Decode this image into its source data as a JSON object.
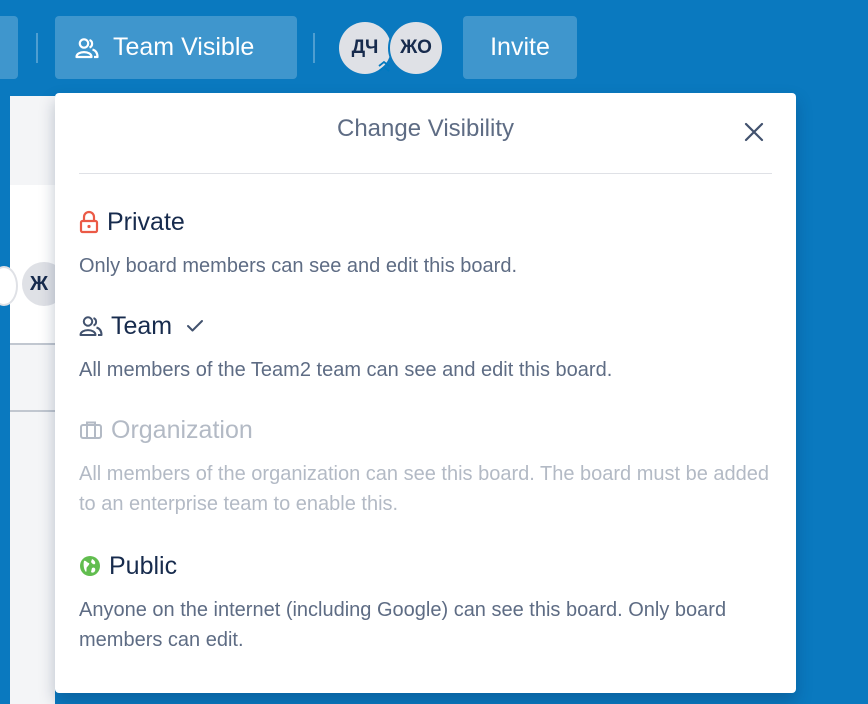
{
  "header": {
    "visibility_button_label": "Team Visible",
    "members": [
      {
        "initials": "ДЧ"
      },
      {
        "initials": "ЖО"
      }
    ],
    "invite_label": "Invite"
  },
  "board_background": {
    "partial_avatar_initial": "Ж"
  },
  "popover": {
    "title": "Change Visibility",
    "options": [
      {
        "label": "Private",
        "description": "Only board members can see and edit this board.",
        "icon": "lock-icon",
        "color": "#eb5a46",
        "selected": false,
        "disabled": false
      },
      {
        "label": "Team",
        "description": "All members of the Team2 team can see and edit this board.",
        "icon": "team-icon",
        "color": "#5e6c84",
        "selected": true,
        "disabled": false
      },
      {
        "label": "Organization",
        "description": "All members of the organization can see this board. The board must be added to an enterprise team to enable this.",
        "icon": "organization-icon",
        "color": "#b3bac5",
        "selected": false,
        "disabled": true
      },
      {
        "label": "Public",
        "description": "Anyone on the internet (including Google) can see this board. Only board members can edit.",
        "icon": "globe-icon",
        "color": "#61bd4f",
        "selected": false,
        "disabled": false
      }
    ]
  }
}
